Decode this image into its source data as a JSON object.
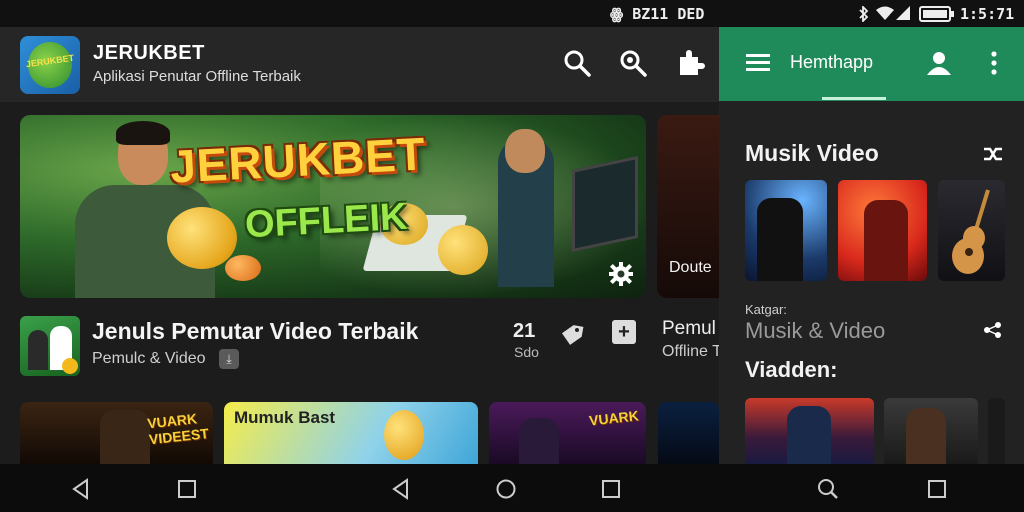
{
  "status_bar": {
    "left_text": "ꙮ BZ11 DED",
    "right_text": "1:5:71"
  },
  "app": {
    "title": "JERUKBET",
    "subtitle": "Aplikasi Penutar Offline Terbaik",
    "logo_text": "JERUKBET"
  },
  "hero": {
    "title": "JERUKBET",
    "subtitle": "OFFLEIK",
    "side_card_label": "Doute"
  },
  "info_row": {
    "title": "Jenuls Pemutar Video Terbaik",
    "subtitle": "Pemulc & Video",
    "count": "21",
    "count_sub": "Sdo",
    "right_title": "Pemul",
    "right_sub": "Offline T"
  },
  "bottom_thumbs": {
    "thumb1_text": "VUARK VIDEEST",
    "thumb2_text": "Mumuk Bast",
    "thumb3_text": "VUARK"
  },
  "drawer": {
    "title": "Hemthapp",
    "section1_title": "Musik Video",
    "section2_label": "Katgar:",
    "section2_title": "Musik & Video",
    "section3_title": "Viadden:"
  },
  "colors": {
    "drawer_header": "#1f8a5a",
    "background": "#1c1c1c",
    "hero_title": "#ffd23d",
    "hero_subtitle": "#9be84c"
  },
  "icons": {
    "header": [
      "search-icon",
      "search-settings-icon",
      "puzzle-icon"
    ],
    "drawer": [
      "menu-icon",
      "user-icon",
      "more-vert-icon"
    ],
    "nav": [
      "back-icon",
      "recents-icon",
      "back-icon",
      "home-icon",
      "recents-icon",
      "search-icon",
      "recents-icon"
    ]
  }
}
